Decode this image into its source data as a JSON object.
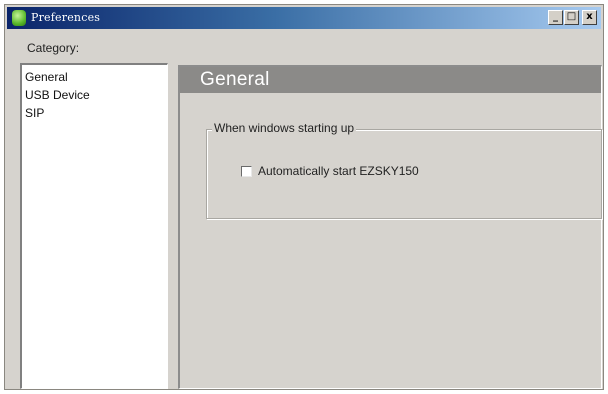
{
  "window": {
    "title": "Preferences",
    "controls": {
      "minimize": "_",
      "maximize": "□",
      "close": "x"
    },
    "icon": "app-icon"
  },
  "sidebar": {
    "label": "Category:",
    "items": [
      {
        "label": "General"
      },
      {
        "label": "USB Device"
      },
      {
        "label": "SIP"
      }
    ]
  },
  "main": {
    "header_title": "General",
    "group": {
      "title": "When windows starting up",
      "checkbox": {
        "label": "Automatically start EZSKY150",
        "checked": false
      }
    }
  },
  "colors": {
    "window_bg": "#d6d3ce",
    "header_bg": "#8b8a88",
    "titlebar_start": "#0a246a",
    "titlebar_end": "#a6caf0"
  }
}
